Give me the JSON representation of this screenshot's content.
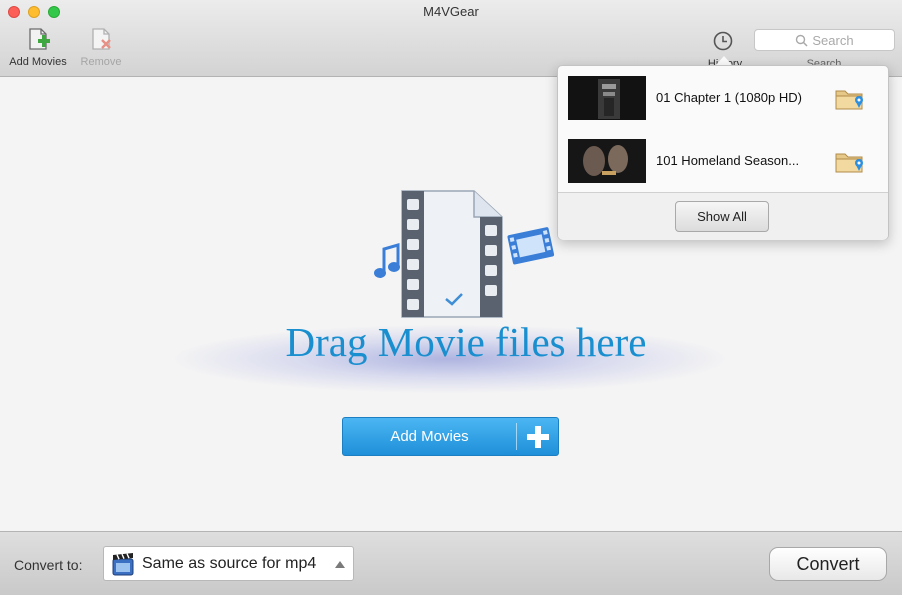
{
  "window": {
    "title": "M4VGear"
  },
  "toolbar": {
    "add_movies_label": "Add Movies",
    "remove_label": "Remove",
    "history_label": "History",
    "search_label": "Search",
    "search_placeholder": "Search"
  },
  "main": {
    "drop_text": "Drag Movie files here",
    "add_movies_button": "Add Movies"
  },
  "history": {
    "items": [
      {
        "name": "01 Chapter 1 (1080p HD)"
      },
      {
        "name": "101 Homeland Season..."
      }
    ],
    "show_all_label": "Show All"
  },
  "bottombar": {
    "convert_to_label": "Convert to:",
    "format_value": "Same as source for mp4",
    "convert_label": "Convert"
  },
  "icons": {
    "add_movies": "add-file-icon",
    "remove": "remove-file-icon",
    "history": "clock-icon",
    "search": "search-icon",
    "folder": "folder-icon",
    "format": "clapperboard-icon"
  },
  "colors": {
    "accent_blue": "#1a8fcf",
    "button_blue": "#2a9be3",
    "add_green": "#3fa73f",
    "remove_red": "#e05a4c"
  }
}
